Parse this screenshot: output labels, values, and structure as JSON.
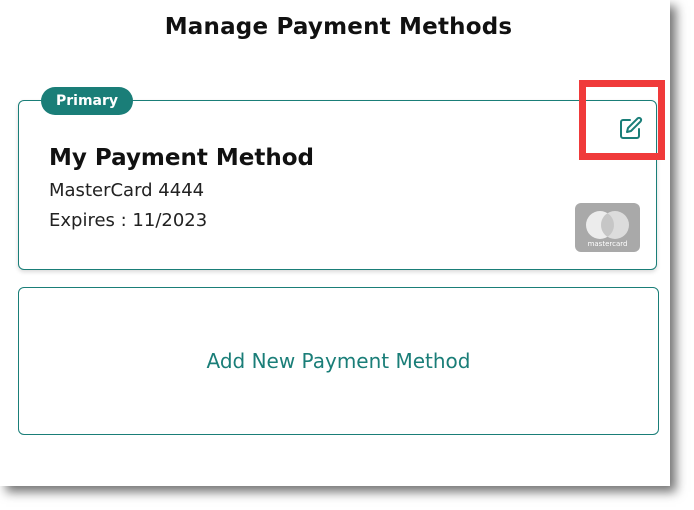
{
  "page": {
    "title": "Manage Payment Methods"
  },
  "primary_card": {
    "badge": "Primary",
    "name": "My Payment Method",
    "number": "MasterCard 4444",
    "expiry": "Expires : 11/2023",
    "brand": "mastercard",
    "edit_icon": "edit-icon"
  },
  "add_method": {
    "label": "Add New Payment Method"
  },
  "colors": {
    "accent": "#1a7e78",
    "highlight": "#f03a3a",
    "brand_logo_bg": "#a9a9a9"
  }
}
